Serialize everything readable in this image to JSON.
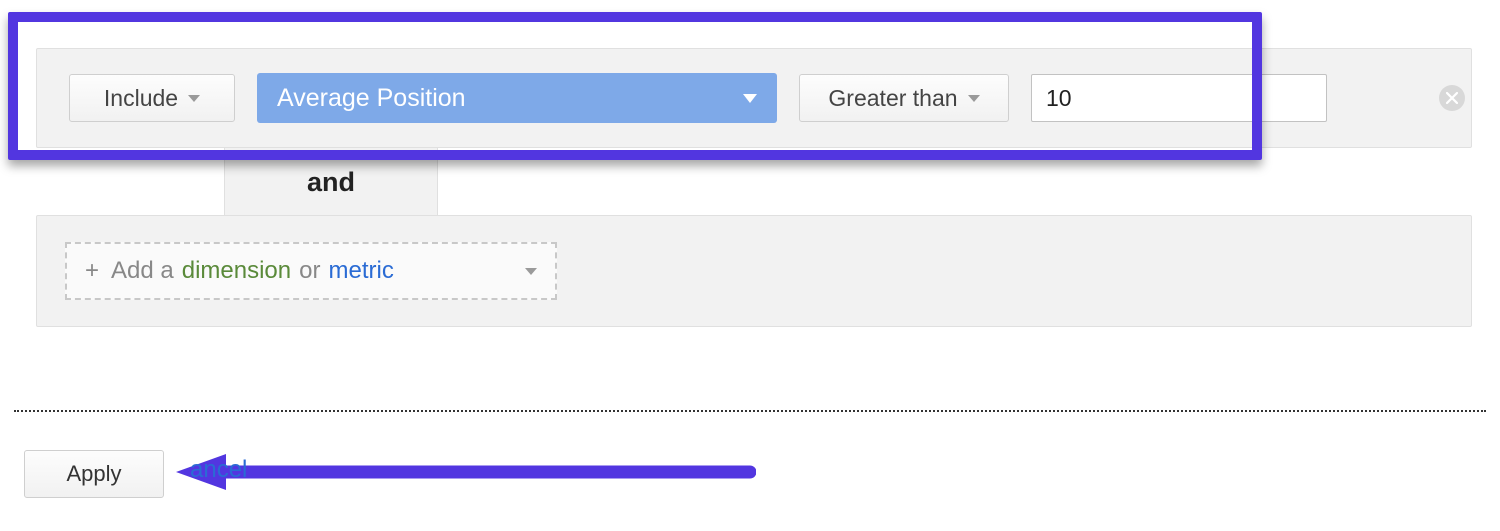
{
  "filterRow": {
    "include_label": "Include",
    "metric_label": "Average Position",
    "condition_label": "Greater than",
    "value": "10"
  },
  "connector": {
    "and_label": "and"
  },
  "addRow": {
    "plus": "+",
    "prefix": "Add a",
    "dimension_word": "dimension",
    "or_word": "or",
    "metric_word": "metric"
  },
  "actions": {
    "apply_label": "Apply",
    "cancel_fragment": "ancel"
  },
  "colors": {
    "highlight": "#5236e0",
    "metric_bg": "#7ea9e8"
  }
}
